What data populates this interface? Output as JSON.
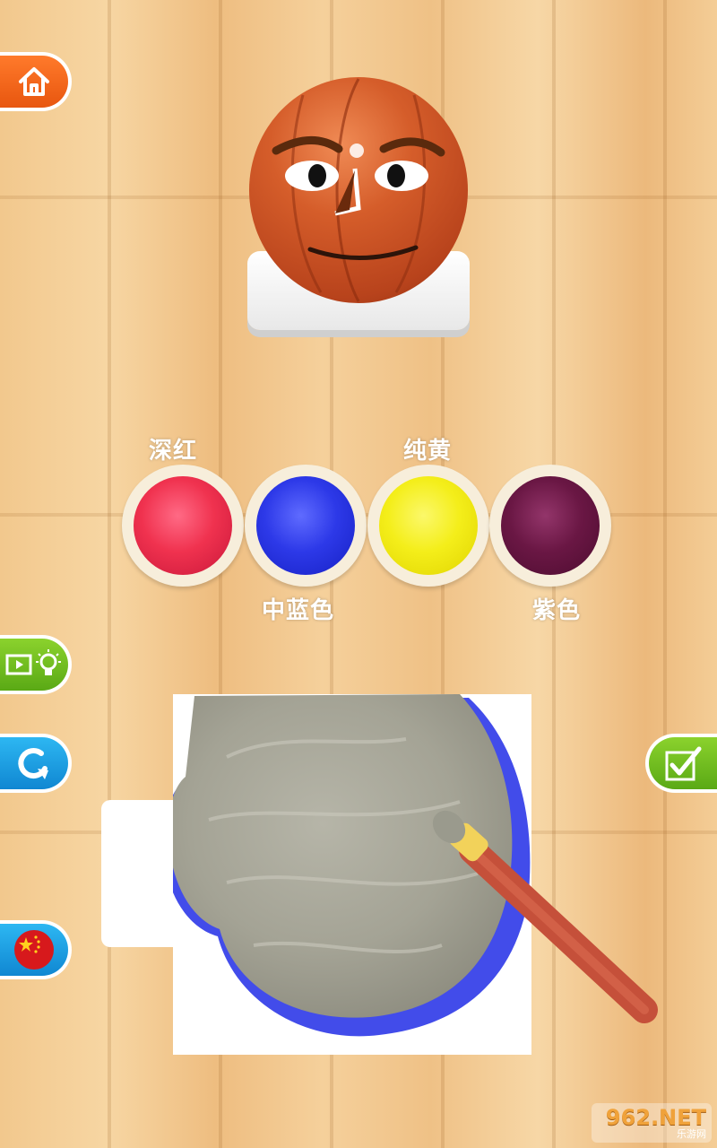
{
  "palette": {
    "colors": [
      {
        "label": "深红",
        "hex": "#f0324f"
      },
      {
        "label": "中蓝色",
        "hex": "#2d39e8"
      },
      {
        "label": "纯黄",
        "hex": "#f4ee1a"
      },
      {
        "label": "紫色",
        "hex": "#6a1744"
      }
    ]
  },
  "buttons": {
    "home_icon": "home-icon",
    "video_hint_icon": "video-lightbulb-icon",
    "redo_icon": "redo-arrow-icon",
    "language_icon": "china-flag-icon",
    "done_icon": "checkmark-icon"
  },
  "watermark": {
    "main": "962.NET",
    "sub": "乐游网"
  }
}
